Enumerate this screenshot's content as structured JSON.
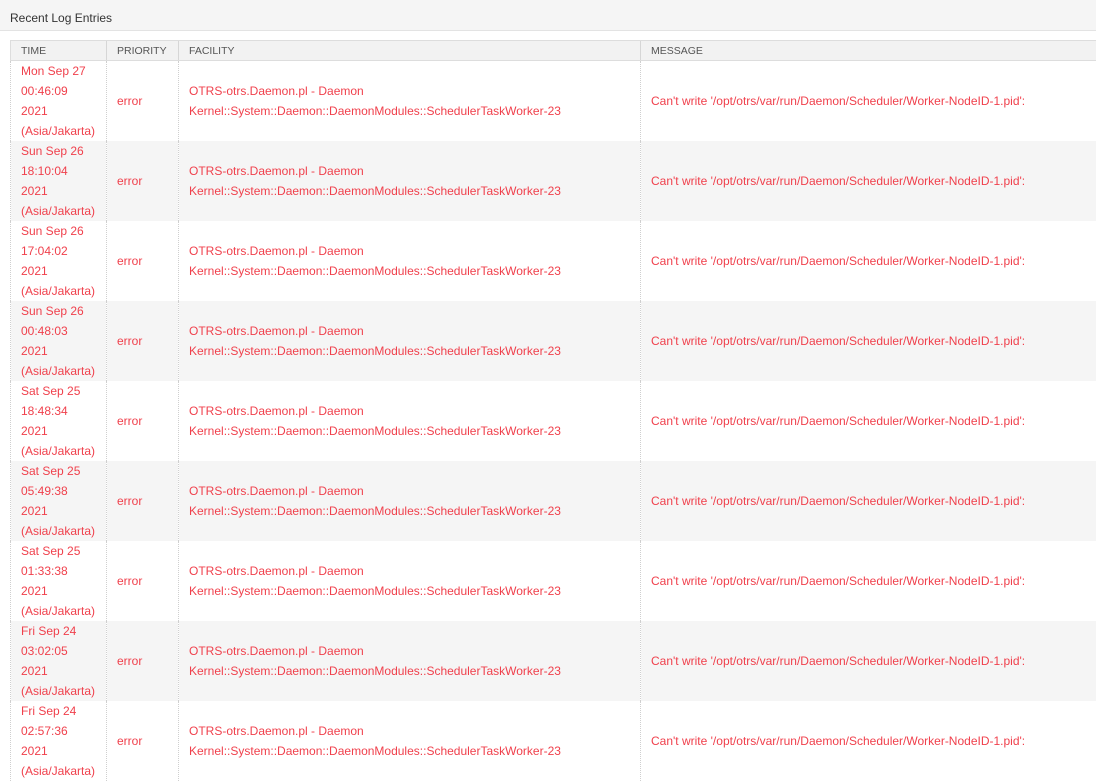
{
  "panel": {
    "title": "Recent Log Entries"
  },
  "table": {
    "headers": {
      "time": "TIME",
      "priority": "PRIORITY",
      "facility": "FACILITY",
      "message": "MESSAGE"
    },
    "rows": [
      {
        "time": [
          "Mon Sep 27",
          "00:46:09",
          "2021",
          "(Asia/Jakarta)"
        ],
        "priority": "error",
        "facility": [
          "OTRS-otrs.Daemon.pl - Daemon",
          "Kernel::System::Daemon::DaemonModules::SchedulerTaskWorker-23"
        ],
        "message": "Can't write '/opt/otrs/var/run/Daemon/Scheduler/Worker-NodeID-1.pid':"
      },
      {
        "time": [
          "Sun Sep 26",
          "18:10:04",
          "2021",
          "(Asia/Jakarta)"
        ],
        "priority": "error",
        "facility": [
          "OTRS-otrs.Daemon.pl - Daemon",
          "Kernel::System::Daemon::DaemonModules::SchedulerTaskWorker-23"
        ],
        "message": "Can't write '/opt/otrs/var/run/Daemon/Scheduler/Worker-NodeID-1.pid':"
      },
      {
        "time": [
          "Sun Sep 26",
          "17:04:02",
          "2021",
          "(Asia/Jakarta)"
        ],
        "priority": "error",
        "facility": [
          "OTRS-otrs.Daemon.pl - Daemon",
          "Kernel::System::Daemon::DaemonModules::SchedulerTaskWorker-23"
        ],
        "message": "Can't write '/opt/otrs/var/run/Daemon/Scheduler/Worker-NodeID-1.pid':"
      },
      {
        "time": [
          "Sun Sep 26",
          "00:48:03",
          "2021",
          "(Asia/Jakarta)"
        ],
        "priority": "error",
        "facility": [
          "OTRS-otrs.Daemon.pl - Daemon",
          "Kernel::System::Daemon::DaemonModules::SchedulerTaskWorker-23"
        ],
        "message": "Can't write '/opt/otrs/var/run/Daemon/Scheduler/Worker-NodeID-1.pid':"
      },
      {
        "time": [
          "Sat Sep 25",
          "18:48:34",
          "2021",
          "(Asia/Jakarta)"
        ],
        "priority": "error",
        "facility": [
          "OTRS-otrs.Daemon.pl - Daemon",
          "Kernel::System::Daemon::DaemonModules::SchedulerTaskWorker-23"
        ],
        "message": "Can't write '/opt/otrs/var/run/Daemon/Scheduler/Worker-NodeID-1.pid':"
      },
      {
        "time": [
          "Sat Sep 25",
          "05:49:38",
          "2021",
          "(Asia/Jakarta)"
        ],
        "priority": "error",
        "facility": [
          "OTRS-otrs.Daemon.pl - Daemon",
          "Kernel::System::Daemon::DaemonModules::SchedulerTaskWorker-23"
        ],
        "message": "Can't write '/opt/otrs/var/run/Daemon/Scheduler/Worker-NodeID-1.pid':"
      },
      {
        "time": [
          "Sat Sep 25",
          "01:33:38",
          "2021",
          "(Asia/Jakarta)"
        ],
        "priority": "error",
        "facility": [
          "OTRS-otrs.Daemon.pl - Daemon",
          "Kernel::System::Daemon::DaemonModules::SchedulerTaskWorker-23"
        ],
        "message": "Can't write '/opt/otrs/var/run/Daemon/Scheduler/Worker-NodeID-1.pid':"
      },
      {
        "time": [
          "Fri Sep 24",
          "03:02:05",
          "2021",
          "(Asia/Jakarta)"
        ],
        "priority": "error",
        "facility": [
          "OTRS-otrs.Daemon.pl - Daemon",
          "Kernel::System::Daemon::DaemonModules::SchedulerTaskWorker-23"
        ],
        "message": "Can't write '/opt/otrs/var/run/Daemon/Scheduler/Worker-NodeID-1.pid':"
      },
      {
        "time": [
          "Fri Sep 24",
          "02:57:36",
          "2021",
          "(Asia/Jakarta)"
        ],
        "priority": "error",
        "facility": [
          "OTRS-otrs.Daemon.pl - Daemon",
          "Kernel::System::Daemon::DaemonModules::SchedulerTaskWorker-23"
        ],
        "message": "Can't write '/opt/otrs/var/run/Daemon/Scheduler/Worker-NodeID-1.pid':"
      }
    ]
  },
  "colors": {
    "error_text": "#f0404c",
    "header_bg": "#f2f2f2",
    "zebra_bg": "#f5f5f5"
  }
}
